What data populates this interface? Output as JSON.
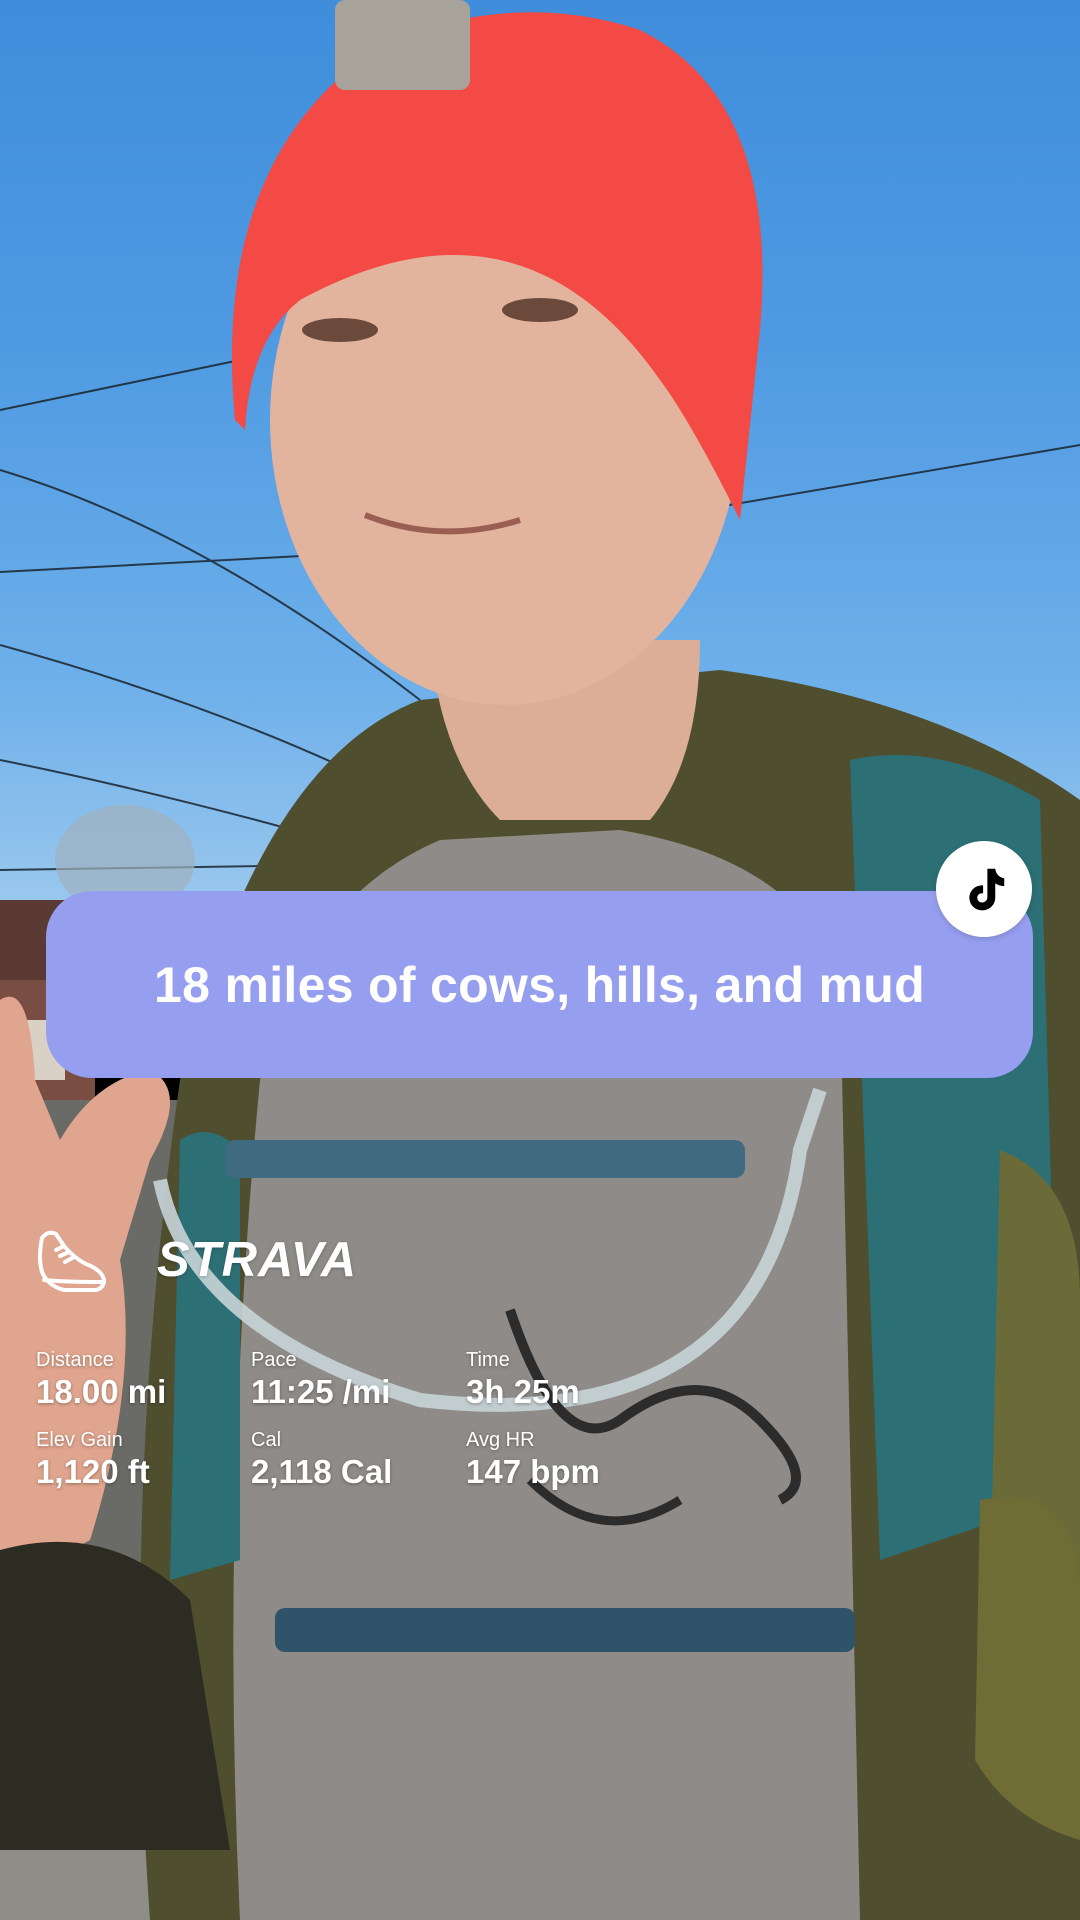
{
  "caption": {
    "text": "18 miles of cows, hills, and mud",
    "background_color": "#969ef0"
  },
  "badge": {
    "icon": "tiktok-icon"
  },
  "strava": {
    "brand": "STRAVA",
    "logo_icon": "running-shoe-icon",
    "stats": [
      {
        "label": "Distance",
        "value": "18.00 mi"
      },
      {
        "label": "Pace",
        "value": "11:25 /mi"
      },
      {
        "label": "Time",
        "value": "3h 25m"
      },
      {
        "label": "Elev Gain",
        "value": "1,120 ft"
      },
      {
        "label": "Cal",
        "value": "2,118 Cal"
      },
      {
        "label": "Avg HR",
        "value": "147 bpm"
      }
    ]
  },
  "colors": {
    "sky": "#4f9ae2",
    "beanie": "#f44a45",
    "hoodie": "#4f4e2e",
    "shirt": "#8e8b88",
    "vest": "#2c6f74"
  }
}
